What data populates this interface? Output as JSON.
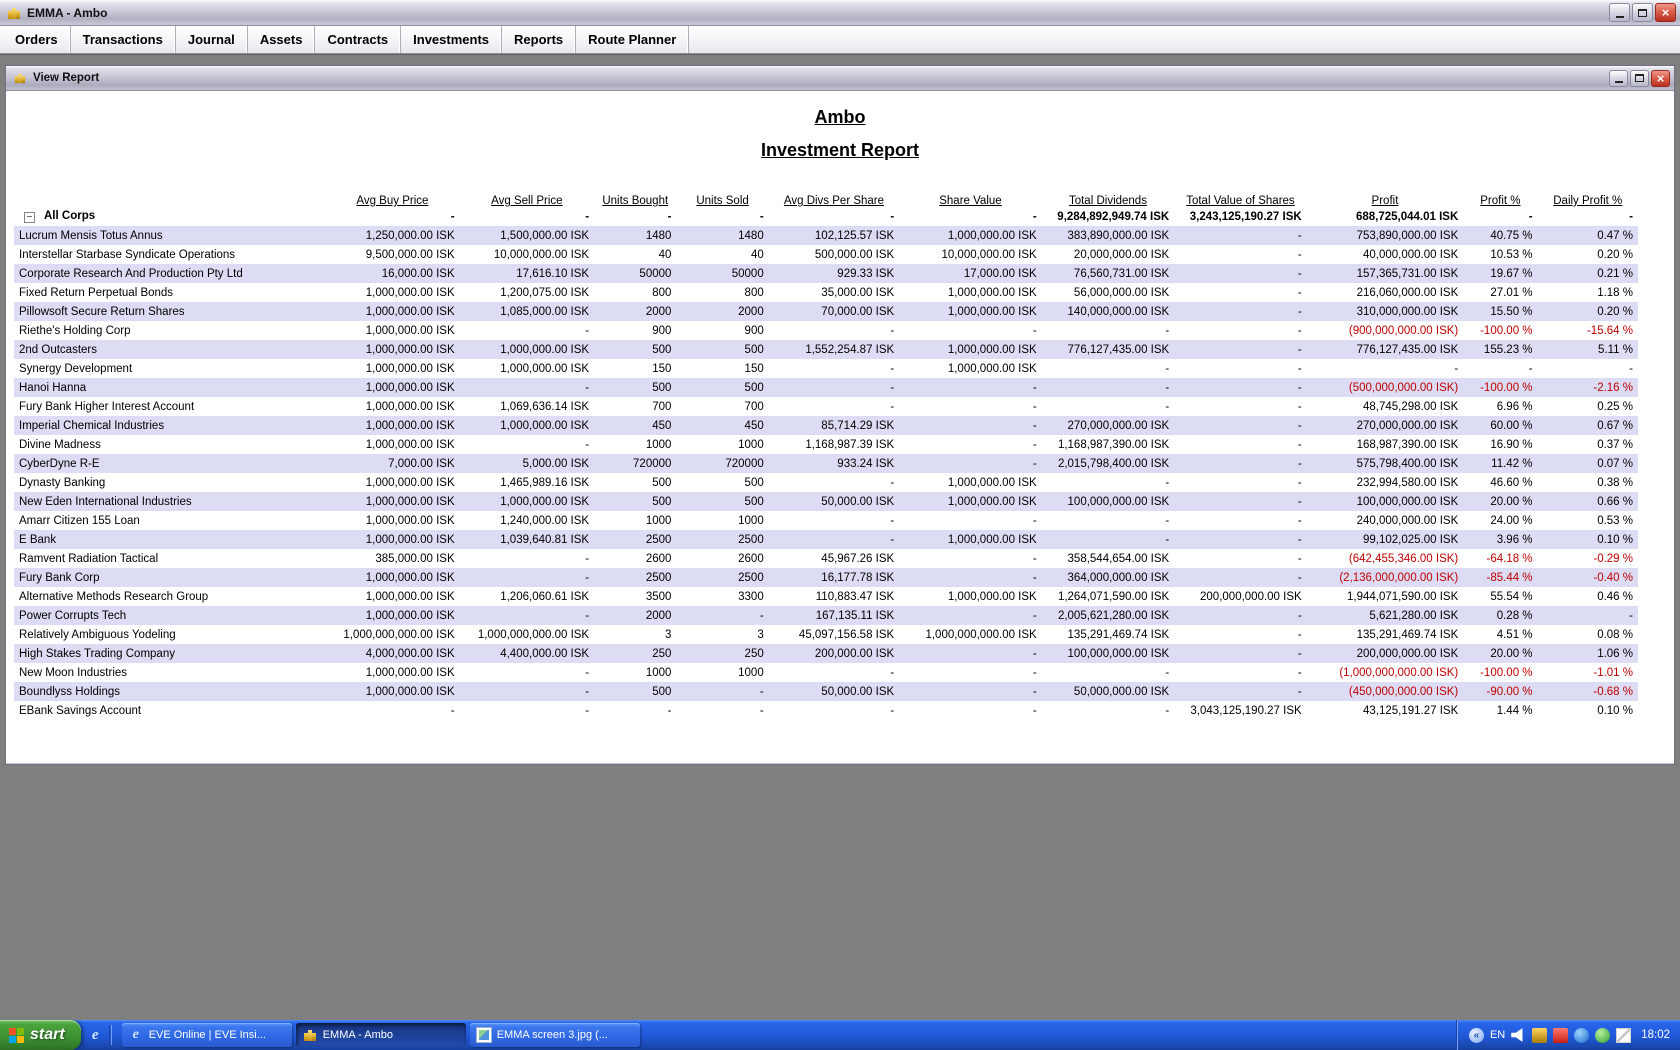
{
  "window": {
    "title": "EMMA - Ambo"
  },
  "menu": {
    "items": [
      "Orders",
      "Transactions",
      "Journal",
      "Assets",
      "Contracts",
      "Investments",
      "Reports",
      "Route Planner"
    ]
  },
  "report": {
    "window_title": "View Report",
    "title": "Ambo",
    "subtitle": "Investment Report",
    "collapse_icon": "minus",
    "columns": [
      "Avg Buy Price",
      "Avg Sell Price",
      "Units Bought",
      "Units Sold",
      "Avg Divs Per Share",
      "Share Value",
      "Total Dividends",
      "Total Value of Shares",
      "Profit",
      "Profit %",
      "Daily Profit %"
    ],
    "summary": {
      "name": "All Corps",
      "cells": [
        "-",
        "-",
        "-",
        "-",
        "-",
        "-",
        "9,284,892,949.74 ISK",
        "3,243,125,190.27 ISK",
        "688,725,044.01 ISK",
        "-",
        "-"
      ]
    },
    "rows": [
      {
        "name": "Lucrum Mensis Totus Annus",
        "cells": [
          "1,250,000.00 ISK",
          "1,500,000.00 ISK",
          "1480",
          "1480",
          "102,125.57 ISK",
          "1,000,000.00 ISK",
          "383,890,000.00 ISK",
          "-",
          "753,890,000.00 ISK",
          "40.75 %",
          "0.47 %"
        ]
      },
      {
        "name": "Interstellar Starbase Syndicate Operations",
        "cells": [
          "9,500,000.00 ISK",
          "10,000,000.00 ISK",
          "40",
          "40",
          "500,000.00 ISK",
          "10,000,000.00 ISK",
          "20,000,000.00 ISK",
          "-",
          "40,000,000.00 ISK",
          "10.53 %",
          "0.20 %"
        ]
      },
      {
        "name": "Corporate Research And Production Pty Ltd",
        "cells": [
          "16,000.00 ISK",
          "17,616.10 ISK",
          "50000",
          "50000",
          "929.33 ISK",
          "17,000.00 ISK",
          "76,560,731.00 ISK",
          "-",
          "157,365,731.00 ISK",
          "19.67 %",
          "0.21 %"
        ]
      },
      {
        "name": "Fixed Return Perpetual Bonds",
        "cells": [
          "1,000,000.00 ISK",
          "1,200,075.00 ISK",
          "800",
          "800",
          "35,000.00 ISK",
          "1,000,000.00 ISK",
          "56,000,000.00 ISK",
          "-",
          "216,060,000.00 ISK",
          "27.01 %",
          "1.18 %"
        ]
      },
      {
        "name": "Pillowsoft Secure Return Shares",
        "cells": [
          "1,000,000.00 ISK",
          "1,085,000.00 ISK",
          "2000",
          "2000",
          "70,000.00 ISK",
          "1,000,000.00 ISK",
          "140,000,000.00 ISK",
          "-",
          "310,000,000.00 ISK",
          "15.50 %",
          "0.20 %"
        ]
      },
      {
        "name": "Riethe's Holding Corp",
        "cells": [
          "1,000,000.00 ISK",
          "-",
          "900",
          "900",
          "-",
          "-",
          "-",
          "-",
          "(900,000,000.00 ISK)",
          "-100.00 %",
          "-15.64 %"
        ]
      },
      {
        "name": "2nd Outcasters",
        "cells": [
          "1,000,000.00 ISK",
          "1,000,000.00 ISK",
          "500",
          "500",
          "1,552,254.87 ISK",
          "1,000,000.00 ISK",
          "776,127,435.00 ISK",
          "-",
          "776,127,435.00 ISK",
          "155.23 %",
          "5.11 %"
        ]
      },
      {
        "name": "Synergy Development",
        "cells": [
          "1,000,000.00 ISK",
          "1,000,000.00 ISK",
          "150",
          "150",
          "-",
          "1,000,000.00 ISK",
          "-",
          "-",
          "-",
          "-",
          "-"
        ]
      },
      {
        "name": "Hanoi Hanna",
        "cells": [
          "1,000,000.00 ISK",
          "-",
          "500",
          "500",
          "-",
          "-",
          "-",
          "-",
          "(500,000,000.00 ISK)",
          "-100.00 %",
          "-2.16 %"
        ]
      },
      {
        "name": "Fury Bank Higher Interest Account",
        "cells": [
          "1,000,000.00 ISK",
          "1,069,636.14 ISK",
          "700",
          "700",
          "-",
          "-",
          "-",
          "-",
          "48,745,298.00 ISK",
          "6.96 %",
          "0.25 %"
        ]
      },
      {
        "name": "Imperial Chemical Industries",
        "cells": [
          "1,000,000.00 ISK",
          "1,000,000.00 ISK",
          "450",
          "450",
          "85,714.29 ISK",
          "-",
          "270,000,000.00 ISK",
          "-",
          "270,000,000.00 ISK",
          "60.00 %",
          "0.67 %"
        ]
      },
      {
        "name": "Divine Madness",
        "cells": [
          "1,000,000.00 ISK",
          "-",
          "1000",
          "1000",
          "1,168,987.39 ISK",
          "-",
          "1,168,987,390.00 ISK",
          "-",
          "168,987,390.00 ISK",
          "16.90 %",
          "0.37 %"
        ]
      },
      {
        "name": "CyberDyne R-E",
        "cells": [
          "7,000.00 ISK",
          "5,000.00 ISK",
          "720000",
          "720000",
          "933.24 ISK",
          "-",
          "2,015,798,400.00 ISK",
          "-",
          "575,798,400.00 ISK",
          "11.42 %",
          "0.07 %"
        ]
      },
      {
        "name": "Dynasty Banking",
        "cells": [
          "1,000,000.00 ISK",
          "1,465,989.16 ISK",
          "500",
          "500",
          "-",
          "1,000,000.00 ISK",
          "-",
          "-",
          "232,994,580.00 ISK",
          "46.60 %",
          "0.38 %"
        ]
      },
      {
        "name": "New Eden International Industries",
        "cells": [
          "1,000,000.00 ISK",
          "1,000,000.00 ISK",
          "500",
          "500",
          "50,000.00 ISK",
          "1,000,000.00 ISK",
          "100,000,000.00 ISK",
          "-",
          "100,000,000.00 ISK",
          "20.00 %",
          "0.66 %"
        ]
      },
      {
        "name": "Amarr Citizen 155 Loan",
        "cells": [
          "1,000,000.00 ISK",
          "1,240,000.00 ISK",
          "1000",
          "1000",
          "-",
          "-",
          "-",
          "-",
          "240,000,000.00 ISK",
          "24.00 %",
          "0.53 %"
        ]
      },
      {
        "name": "E Bank",
        "cells": [
          "1,000,000.00 ISK",
          "1,039,640.81 ISK",
          "2500",
          "2500",
          "-",
          "1,000,000.00 ISK",
          "-",
          "-",
          "99,102,025.00 ISK",
          "3.96 %",
          "0.10 %"
        ]
      },
      {
        "name": "Ramvent Radiation Tactical",
        "cells": [
          "385,000.00 ISK",
          "-",
          "2600",
          "2600",
          "45,967.26 ISK",
          "-",
          "358,544,654.00 ISK",
          "-",
          "(642,455,346.00 ISK)",
          "-64.18 %",
          "-0.29 %"
        ]
      },
      {
        "name": "Fury Bank Corp",
        "cells": [
          "1,000,000.00 ISK",
          "-",
          "2500",
          "2500",
          "16,177.78 ISK",
          "-",
          "364,000,000.00 ISK",
          "-",
          "(2,136,000,000.00 ISK)",
          "-85.44 %",
          "-0.40 %"
        ]
      },
      {
        "name": "Alternative Methods Research Group",
        "cells": [
          "1,000,000.00 ISK",
          "1,206,060.61 ISK",
          "3500",
          "3300",
          "110,883.47 ISK",
          "1,000,000.00 ISK",
          "1,264,071,590.00 ISK",
          "200,000,000.00 ISK",
          "1,944,071,590.00 ISK",
          "55.54 %",
          "0.46 %"
        ]
      },
      {
        "name": "Power Corrupts Tech",
        "cells": [
          "1,000,000.00 ISK",
          "-",
          "2000",
          "-",
          "167,135.11 ISK",
          "-",
          "2,005,621,280.00 ISK",
          "-",
          "5,621,280.00 ISK",
          "0.28 %",
          "-"
        ]
      },
      {
        "name": "Relatively Ambiguous Yodeling",
        "cells": [
          "1,000,000,000.00 ISK",
          "1,000,000,000.00 ISK",
          "3",
          "3",
          "45,097,156.58 ISK",
          "1,000,000,000.00 ISK",
          "135,291,469.74 ISK",
          "-",
          "135,291,469.74 ISK",
          "4.51 %",
          "0.08 %"
        ]
      },
      {
        "name": "High Stakes Trading Company",
        "cells": [
          "4,000,000.00 ISK",
          "4,400,000.00 ISK",
          "250",
          "250",
          "200,000.00 ISK",
          "-",
          "100,000,000.00 ISK",
          "-",
          "200,000,000.00 ISK",
          "20.00 %",
          "1.06 %"
        ]
      },
      {
        "name": "New Moon Industries",
        "cells": [
          "1,000,000.00 ISK",
          "-",
          "1000",
          "1000",
          "-",
          "-",
          "-",
          "-",
          "(1,000,000,000.00 ISK)",
          "-100.00 %",
          "-1.01 %"
        ]
      },
      {
        "name": "Boundlyss Holdings",
        "cells": [
          "1,000,000.00 ISK",
          "-",
          "500",
          "-",
          "50,000.00 ISK",
          "-",
          "50,000,000.00 ISK",
          "-",
          "(450,000,000.00 ISK)",
          "-90.00 %",
          "-0.68 %"
        ]
      },
      {
        "name": "EBank Savings Account",
        "cells": [
          "-",
          "-",
          "-",
          "-",
          "-",
          "-",
          "-",
          "3,043,125,190.27 ISK",
          "43,125,191.27 ISK",
          "1.44 %",
          "0.10 %"
        ]
      }
    ]
  },
  "taskbar": {
    "start_label": "start",
    "tasks": [
      {
        "label": "EVE Online | EVE Insi...",
        "icon": "ie",
        "active": false
      },
      {
        "label": "EMMA - Ambo",
        "icon": "emma",
        "active": true
      },
      {
        "label": "EMMA screen 3.jpg (...",
        "icon": "image",
        "active": false
      }
    ],
    "tray": {
      "language": "EN",
      "time": "18:02",
      "icons": [
        {
          "name": "volume-icon",
          "style": "volume"
        },
        {
          "name": "emma-tray-icon",
          "style": "gold"
        },
        {
          "name": "alert-icon",
          "style": "red"
        },
        {
          "name": "update-icon",
          "style": "blue"
        },
        {
          "name": "messenger-icon",
          "style": "green"
        },
        {
          "name": "mail-icon",
          "style": "mail"
        }
      ]
    }
  },
  "colors": {
    "negative": "#c00000",
    "row_alt": "#dcdcf4",
    "taskbar_blue": "#2158d8",
    "start_green": "#3d8f33"
  }
}
